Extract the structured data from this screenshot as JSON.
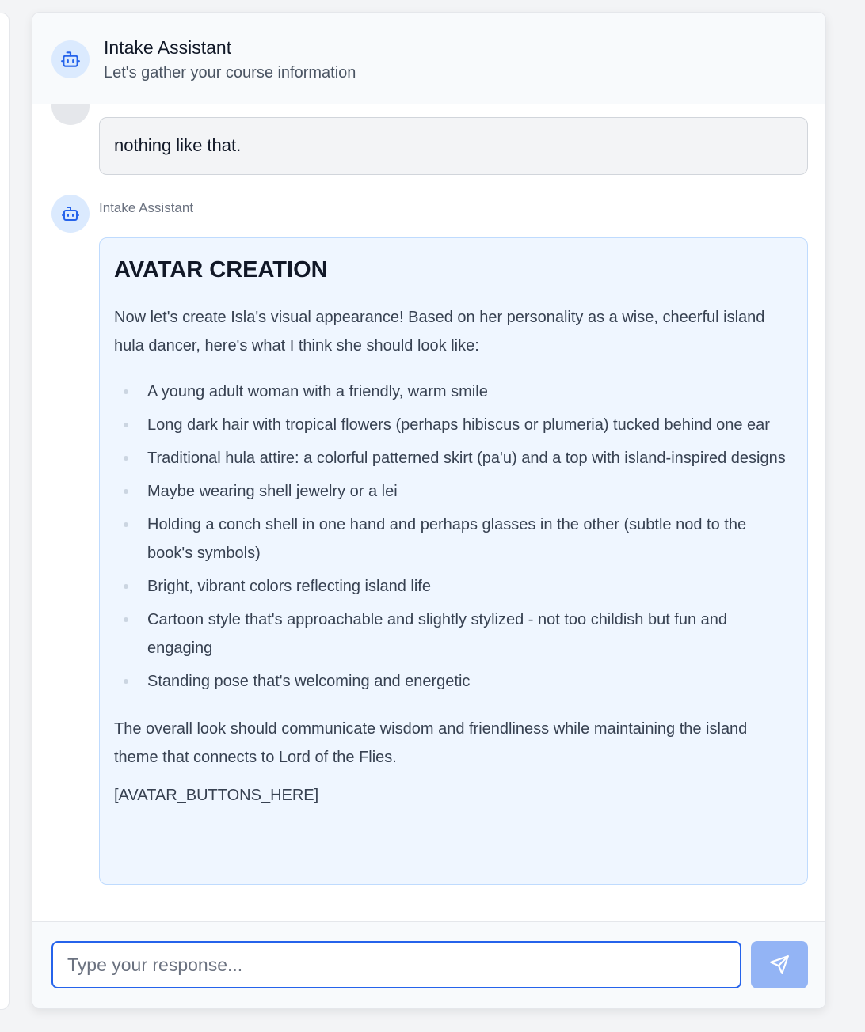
{
  "header": {
    "title": "Intake Assistant",
    "subtitle": "Let's gather your course information",
    "icon": "robot-icon"
  },
  "messages": {
    "user_message": "nothing like that.",
    "bot_sender": "Intake Assistant",
    "bot_message": {
      "heading": "AVATAR CREATION",
      "intro": "Now let's create Isla's visual appearance! Based on her personality as a wise, cheerful island hula dancer, here's what I think she should look like:",
      "bullets": [
        "A young adult woman with a friendly, warm smile",
        "Long dark hair with tropical flowers (perhaps hibiscus or plumeria) tucked behind one ear",
        "Traditional hula attire: a colorful patterned skirt (pa'u) and a top with island-inspired designs",
        "Maybe wearing shell jewelry or a lei",
        "Holding a conch shell in one hand and perhaps glasses in the other (subtle nod to the book's symbols)",
        "Bright, vibrant colors reflecting island life",
        "Cartoon style that's approachable and slightly stylized - not too childish but fun and engaging",
        "Standing pose that's welcoming and energetic"
      ],
      "closing": "The overall look should communicate wisdom and friendliness while maintaining the island theme that connects to Lord of the Flies.",
      "placeholder_token": "[AVATAR_BUTTONS_HERE]"
    }
  },
  "input": {
    "value": "",
    "placeholder": "Type your response...",
    "send_icon": "send-icon"
  },
  "colors": {
    "accent": "#2563eb",
    "avatar_bg": "#dbeafe",
    "bot_bubble_bg": "#eff6ff",
    "user_bubble_bg": "#f3f4f6",
    "send_button_bg": "#93b4f5"
  }
}
